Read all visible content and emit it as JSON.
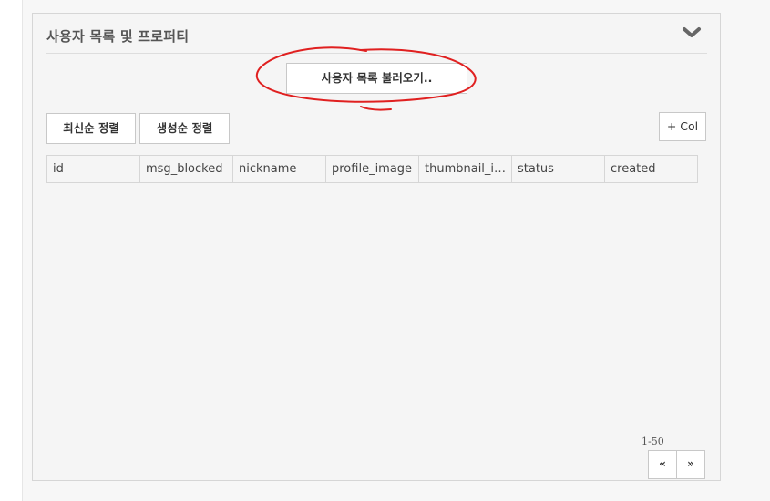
{
  "panel": {
    "title": "사용자 목록 및 프로퍼티",
    "collapse_icon": "chevron-down-icon"
  },
  "toolbar": {
    "load_label": "사용자 목록 불러오기..",
    "sort_latest_label": "최신순 정렬",
    "sort_created_label": "생성순 정렬",
    "add_col_label": "+ Col"
  },
  "table": {
    "columns": [
      "id",
      "msg_blocked",
      "nickname",
      "profile_image",
      "thumbnail_image",
      "status",
      "created"
    ]
  },
  "pagination": {
    "range_label": "1-50",
    "prev_label": "«",
    "next_label": "»"
  },
  "annotation": {
    "color": "#e02020",
    "shape": "hand-drawn circle around load button"
  }
}
